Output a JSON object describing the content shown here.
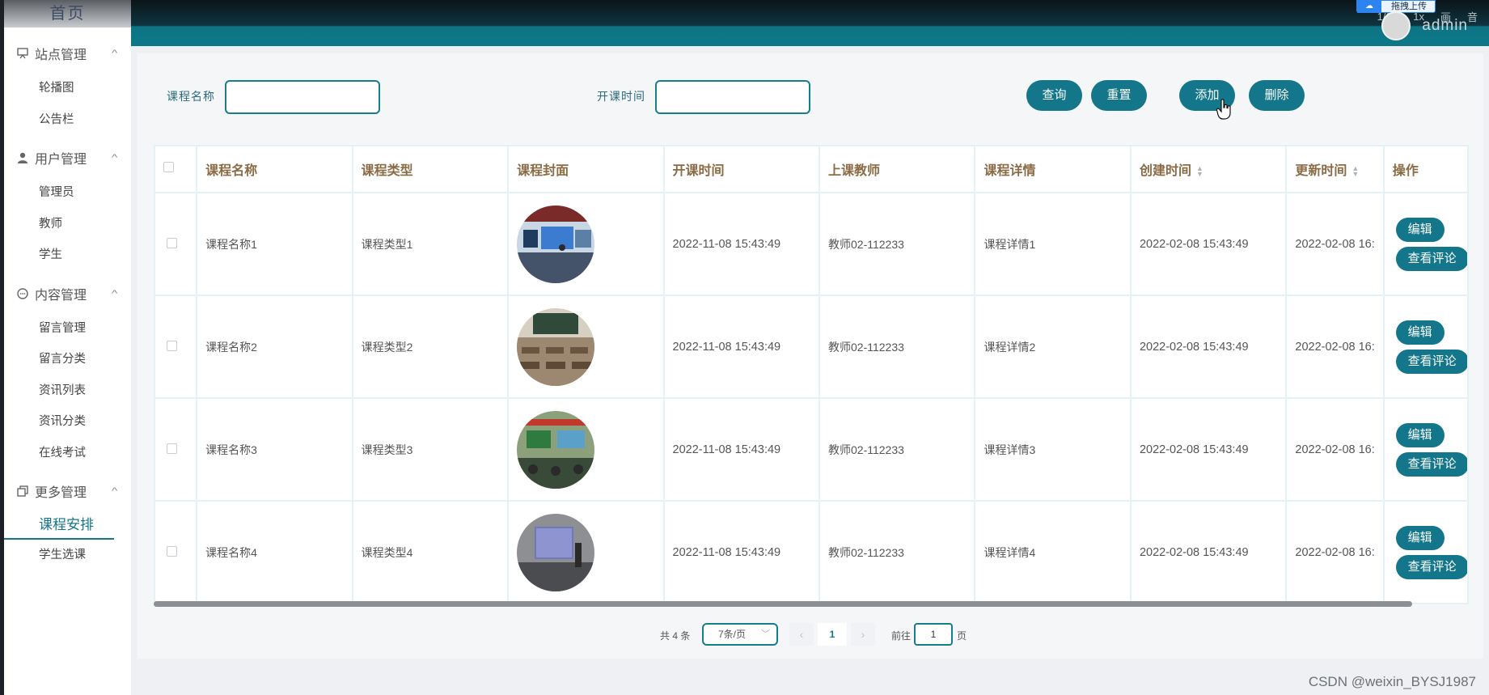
{
  "sidebar": {
    "home": "首页",
    "groups": [
      {
        "label": "站点管理",
        "icon": "monitor-icon",
        "items": [
          "轮播图",
          "公告栏"
        ]
      },
      {
        "label": "用户管理",
        "icon": "user-icon",
        "items": [
          "管理员",
          "教师",
          "学生"
        ]
      },
      {
        "label": "内容管理",
        "icon": "chat-icon",
        "items": [
          "留言管理",
          "留言分类",
          "资讯列表",
          "资讯分类",
          "在线考试"
        ]
      },
      {
        "label": "更多管理",
        "icon": "copy-icon",
        "items": [
          "课程安排",
          "学生选课"
        ]
      }
    ],
    "active_item": "课程安排"
  },
  "header": {
    "top_right": [
      "1/2x",
      "1x",
      "画",
      "音"
    ],
    "upload_badge": "拖拽上传",
    "user_name": "admin"
  },
  "search": {
    "course_name_label": "课程名称",
    "start_time_label": "开课时间",
    "query_button": "查询",
    "reset_button": "重置",
    "add_button": "添加",
    "delete_button": "删除"
  },
  "table": {
    "columns": [
      "课程名称",
      "课程类型",
      "课程封面",
      "开课时间",
      "上课教师",
      "课程详情",
      "创建时间",
      "更新时间",
      "操作"
    ],
    "rows": [
      {
        "name": "课程名称1",
        "type": "课程类型1",
        "start": "2022-11-08 15:43:49",
        "teacher": "教师02-112233",
        "detail": "课程详情1",
        "created": "2022-02-08 15:43:49",
        "updated": "2022-02-08 16:"
      },
      {
        "name": "课程名称2",
        "type": "课程类型2",
        "start": "2022-11-08 15:43:49",
        "teacher": "教师02-112233",
        "detail": "课程详情2",
        "created": "2022-02-08 15:43:49",
        "updated": "2022-02-08 16:"
      },
      {
        "name": "课程名称3",
        "type": "课程类型3",
        "start": "2022-11-08 15:43:49",
        "teacher": "教师02-112233",
        "detail": "课程详情3",
        "created": "2022-02-08 15:43:49",
        "updated": "2022-02-08 16:"
      },
      {
        "name": "课程名称4",
        "type": "课程类型4",
        "start": "2022-11-08 15:43:49",
        "teacher": "教师02-112233",
        "detail": "课程详情4",
        "created": "2022-02-08 15:43:49",
        "updated": "2022-02-08 16:"
      }
    ],
    "edit_button": "编辑",
    "view_comments_button": "查看评论"
  },
  "pagination": {
    "total": "共 4 条",
    "page_size": "7条/页",
    "current_page": "1",
    "goto_label": "前往",
    "goto_value": "1",
    "page_suffix": "页"
  },
  "watermark": "CSDN @weixin_BYSJ1987",
  "colors": {
    "primary": "#14768a",
    "header_dark": "#0b1418",
    "header_header_accent": "#0d7688",
    "column_header_text": "#8a6b45"
  }
}
